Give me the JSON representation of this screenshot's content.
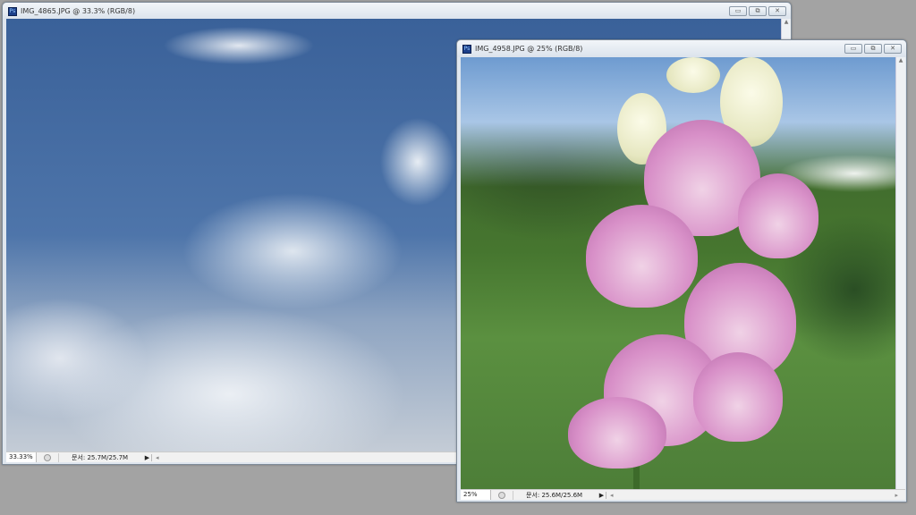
{
  "windows": [
    {
      "title": "IMG_4865.JPG @ 33.3% (RGB/8)",
      "zoom": "33.33%",
      "doc": "문서: 25.7M/25.7M"
    },
    {
      "title": "IMG_4958.JPG @ 25% (RGB/8)",
      "zoom": "25%",
      "doc": "문서: 25.6M/25.6M"
    }
  ],
  "controls": {
    "minimize": "▭",
    "restore": "⧉",
    "close": "✕"
  },
  "app_icon": "Ps",
  "scroll": {
    "up": "▲",
    "down": "▼",
    "left": "◂",
    "right": "▸",
    "menu": "▶"
  }
}
